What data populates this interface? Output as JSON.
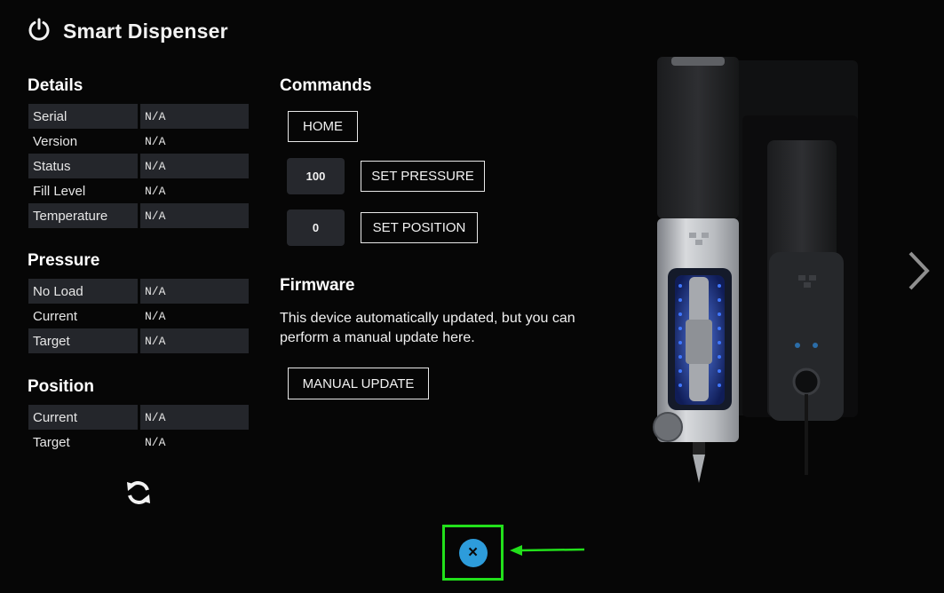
{
  "app": {
    "title": "Smart Dispenser"
  },
  "details": {
    "heading": "Details",
    "rows": [
      {
        "label": "Serial",
        "value": "N/A"
      },
      {
        "label": "Version",
        "value": "N/A"
      },
      {
        "label": "Status",
        "value": "N/A"
      },
      {
        "label": "Fill Level",
        "value": "N/A"
      },
      {
        "label": "Temperature",
        "value": "N/A"
      }
    ]
  },
  "pressure": {
    "heading": "Pressure",
    "rows": [
      {
        "label": "No Load",
        "value": "N/A"
      },
      {
        "label": "Current",
        "value": "N/A"
      },
      {
        "label": "Target",
        "value": "N/A"
      }
    ]
  },
  "position": {
    "heading": "Position",
    "rows": [
      {
        "label": "Current",
        "value": "N/A"
      },
      {
        "label": "Target",
        "value": "N/A"
      }
    ]
  },
  "commands": {
    "heading": "Commands",
    "home_label": "HOME",
    "pressure_value": "100",
    "set_pressure_label": "SET PRESSURE",
    "position_value": "0",
    "set_position_label": "SET POSITION"
  },
  "firmware": {
    "heading": "Firmware",
    "description": "This device automatically updated, but you can perform a manual update here.",
    "manual_update_label": "MANUAL UPDATE"
  },
  "icons": {
    "power": "power-icon",
    "refresh": "refresh-icon",
    "next": "chevron-right-icon",
    "close": "close-icon"
  },
  "colors": {
    "background": "#060606",
    "accent": "#2d9cdb",
    "highlight": "#22e01b",
    "row_shade": "#24262b"
  },
  "close_symbol": "×"
}
